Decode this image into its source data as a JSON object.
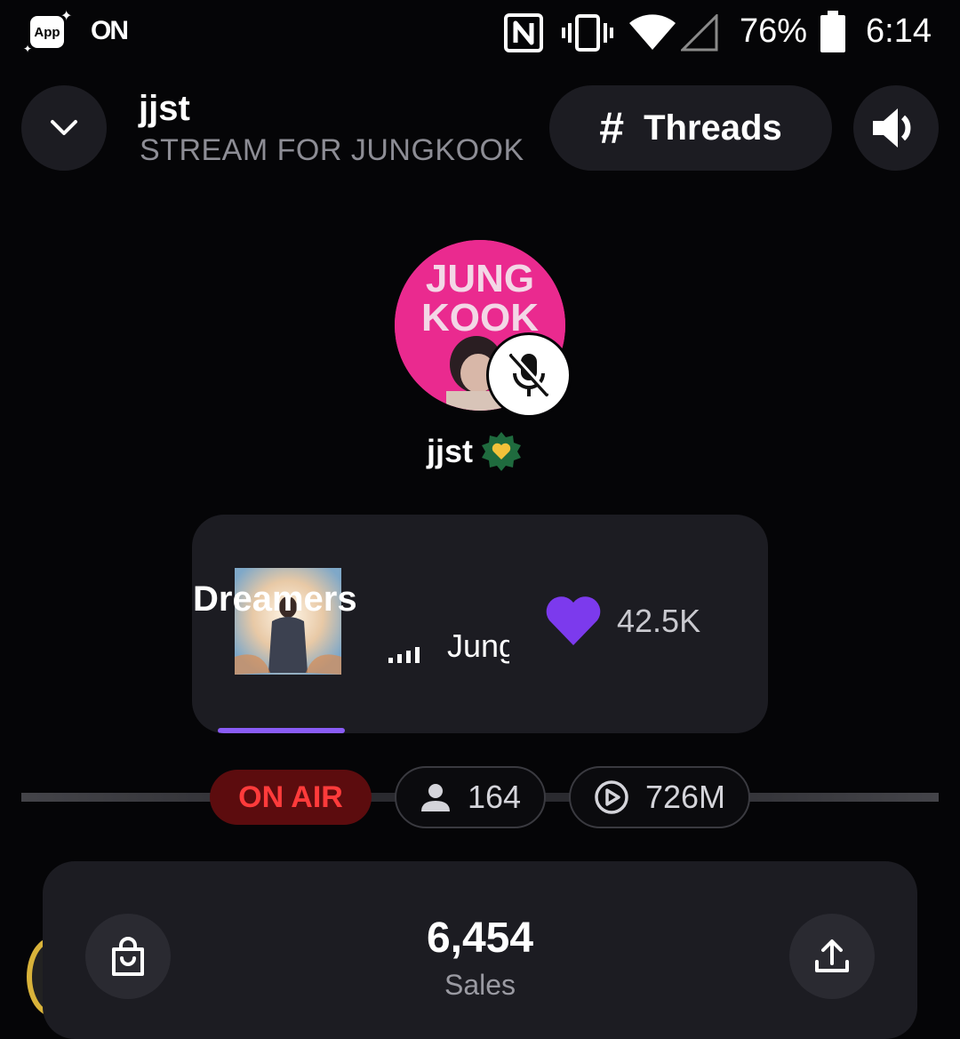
{
  "status_bar": {
    "app_badge": "App",
    "on_label": "ON",
    "battery": "76%",
    "time": "6:14"
  },
  "header": {
    "room_name": "jjst",
    "room_subtitle": "STREAM FOR JUNGKOOK",
    "threads_label": "Threads"
  },
  "host": {
    "avatar_text_line1": "JUNG",
    "avatar_text_line2": "KOOK",
    "name": "jjst"
  },
  "now_playing": {
    "title": "Dreamers",
    "artist": "Jung Kook",
    "likes": "42.5K",
    "progress": 0.22,
    "accent_color": "#8a5cf6"
  },
  "stats": {
    "on_air": "ON AIR",
    "listeners": "164",
    "plays": "726M"
  },
  "sales": {
    "count": "6,454",
    "label": "Sales"
  },
  "icons": [
    "collapse-chevron-icon",
    "hash-icon",
    "speaker-icon",
    "mic-off-icon",
    "verified-heart-badge-icon",
    "equalizer-icon",
    "heart-icon",
    "person-icon",
    "play-circle-icon",
    "shopping-bag-icon",
    "share-upload-icon"
  ]
}
